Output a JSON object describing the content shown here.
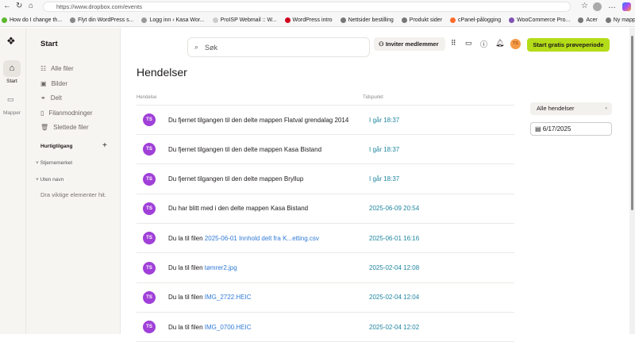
{
  "browser": {
    "url": "https://www.dropbox.com/events",
    "bookmarks": [
      {
        "label": "How do I change th...",
        "color": "#5cb82e"
      },
      {
        "label": "Flyt din WordPress s...",
        "color": "#888"
      },
      {
        "label": "Logg inn ‹ Kasa Wor...",
        "color": "#999"
      },
      {
        "label": "ProISP Webmail :: W...",
        "color": "#ccc"
      },
      {
        "label": "WordPress intro",
        "color": "#d0021b"
      },
      {
        "label": "Nettsider bestilling",
        "color": "#777"
      },
      {
        "label": "Produkt sider",
        "color": "#777"
      },
      {
        "label": "cPanel-pålogging",
        "color": "#ff6c2c"
      },
      {
        "label": "WooCommerce Pro...",
        "color": "#7f54b3"
      },
      {
        "label": "Acer",
        "color": "#777"
      },
      {
        "label": "Ny mappe",
        "color": "#777"
      }
    ]
  },
  "rail": {
    "start": "Start",
    "folders": "Mapper"
  },
  "sidebar": {
    "title": "Start",
    "items": [
      {
        "label": "Alle filer",
        "icon": "files-icon"
      },
      {
        "label": "Bilder",
        "icon": "photos-icon"
      },
      {
        "label": "Delt",
        "icon": "shared-icon"
      },
      {
        "label": "Filanmodninger",
        "icon": "file-request-icon"
      },
      {
        "label": "Slettede filer",
        "icon": "trash-icon"
      }
    ],
    "quick_access": "Hurtigtilgang",
    "starred": "Stjernemerket",
    "unnamed": "Uten navn",
    "drag_hint": "Dra viktige elementer hit."
  },
  "header": {
    "search_placeholder": "Søk",
    "invite": "Inviter medlemmer",
    "avatar": "TS",
    "trial": "Start gratis prøveperiode",
    "accent": "#b4dc19"
  },
  "main": {
    "title": "Hendelser",
    "col_event": "Hendelse",
    "col_time": "Tidspunkt",
    "filter": "Alle hendelser",
    "date": "6/17/2025",
    "events": [
      {
        "text": "Du fjernet tilgangen til den delte mappen Flatval grendalag 2014",
        "link": "",
        "time": "I går 18:37"
      },
      {
        "text": "Du fjernet tilgangen til den delte mappen Kasa Bistand",
        "link": "",
        "time": "I går 18:37"
      },
      {
        "text": "Du fjernet tilgangen til den delte mappen Bryllup",
        "link": "",
        "time": "I går 18:37"
      },
      {
        "text": "Du har blitt med i den delte mappen Kasa Bistand",
        "link": "",
        "time": "2025-06-09 20:54"
      },
      {
        "text": "Du la til filen ",
        "link": "2025-06-01 Innhold delt fra K...etting.csv",
        "time": "2025-06-01 16:16"
      },
      {
        "text": "Du la til filen ",
        "link": "tømrer2.jpg",
        "time": "2025-02-04 12:08"
      },
      {
        "text": "Du la til filen ",
        "link": "IMG_2722.HEIC",
        "time": "2025-02-04 12:04"
      },
      {
        "text": "Du la til filen ",
        "link": "IMG_0700.HEIC",
        "time": "2025-02-04 12:02"
      }
    ]
  }
}
